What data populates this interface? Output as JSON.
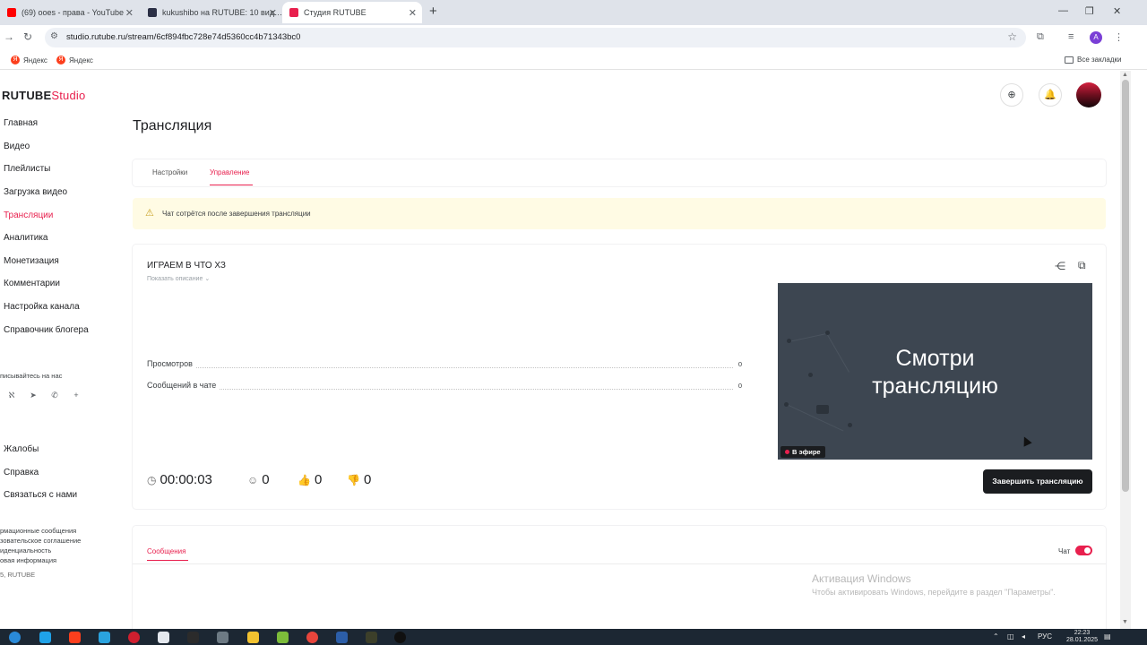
{
  "browser": {
    "tabs": [
      {
        "title": "(69) ooes - права - YouTube",
        "active": false
      },
      {
        "title": "kukushibo на RUTUBE: 10 вид…",
        "active": false
      },
      {
        "title": "Студия RUTUBE",
        "active": true
      }
    ],
    "url": "studio.rutube.ru/stream/6cf894fbc728e74d5360cc4b71343bc0",
    "bookmarks": [
      "Яндекс",
      "Яндекс"
    ],
    "all_bookmarks": "Все закладки",
    "profile_letter": "A"
  },
  "logo": {
    "rutube": "RUTUBE",
    "studio": "Studio"
  },
  "sidebar": {
    "items": [
      {
        "label": "Главная"
      },
      {
        "label": "Видео"
      },
      {
        "label": "Плейлисты"
      },
      {
        "label": "Загрузка видео"
      },
      {
        "label": "Трансляции"
      },
      {
        "label": "Аналитика"
      },
      {
        "label": "Монетизация"
      },
      {
        "label": "Комментарии"
      },
      {
        "label": "Настройка канала"
      },
      {
        "label": "Справочник блогера"
      }
    ],
    "subscribe_label": "писывайтесь на нас",
    "bottom_items": [
      {
        "label": "Жалобы"
      },
      {
        "label": "Справка"
      },
      {
        "label": "Связаться с нами"
      }
    ],
    "footer_links": [
      "рмационные сообщения",
      "зовательское соглашение",
      "иденциальность",
      "овая информация"
    ],
    "copyright": "5, RUTUBE"
  },
  "page": {
    "title": "Трансляция",
    "tabs": [
      {
        "label": "Настройки"
      },
      {
        "label": "Управление"
      }
    ],
    "warning": "Чат сотрётся после завершения трансляции"
  },
  "stream": {
    "title": "ИГРАЕМ В ЧТО ХЗ",
    "show_description": "Показать описание",
    "stats": [
      {
        "label": "Просмотров",
        "value": "0"
      },
      {
        "label": "Сообщений в чате",
        "value": "0"
      }
    ],
    "duration": "00:00:03",
    "viewers": "0",
    "likes": "0",
    "dislikes": "0",
    "preview_text_line1": "Смотри",
    "preview_text_line2": "трансляцию",
    "live_badge": "В эфире",
    "end_button": "Завершить трансляцию"
  },
  "chat": {
    "tab_label": "Сообщения",
    "toggle_label": "Чат",
    "toggle_on": true
  },
  "watermark": {
    "line1": "Активация Windows",
    "line2": "Чтобы активировать Windows, перейдите в раздел \"Параметры\"."
  },
  "taskbar": {
    "lang": "РУС",
    "time": "22:23",
    "date": "28.01.2025"
  },
  "colors": {
    "accent": "#e8204e",
    "dark_button": "#1b1d20",
    "warning_bg": "#fffbe4"
  }
}
